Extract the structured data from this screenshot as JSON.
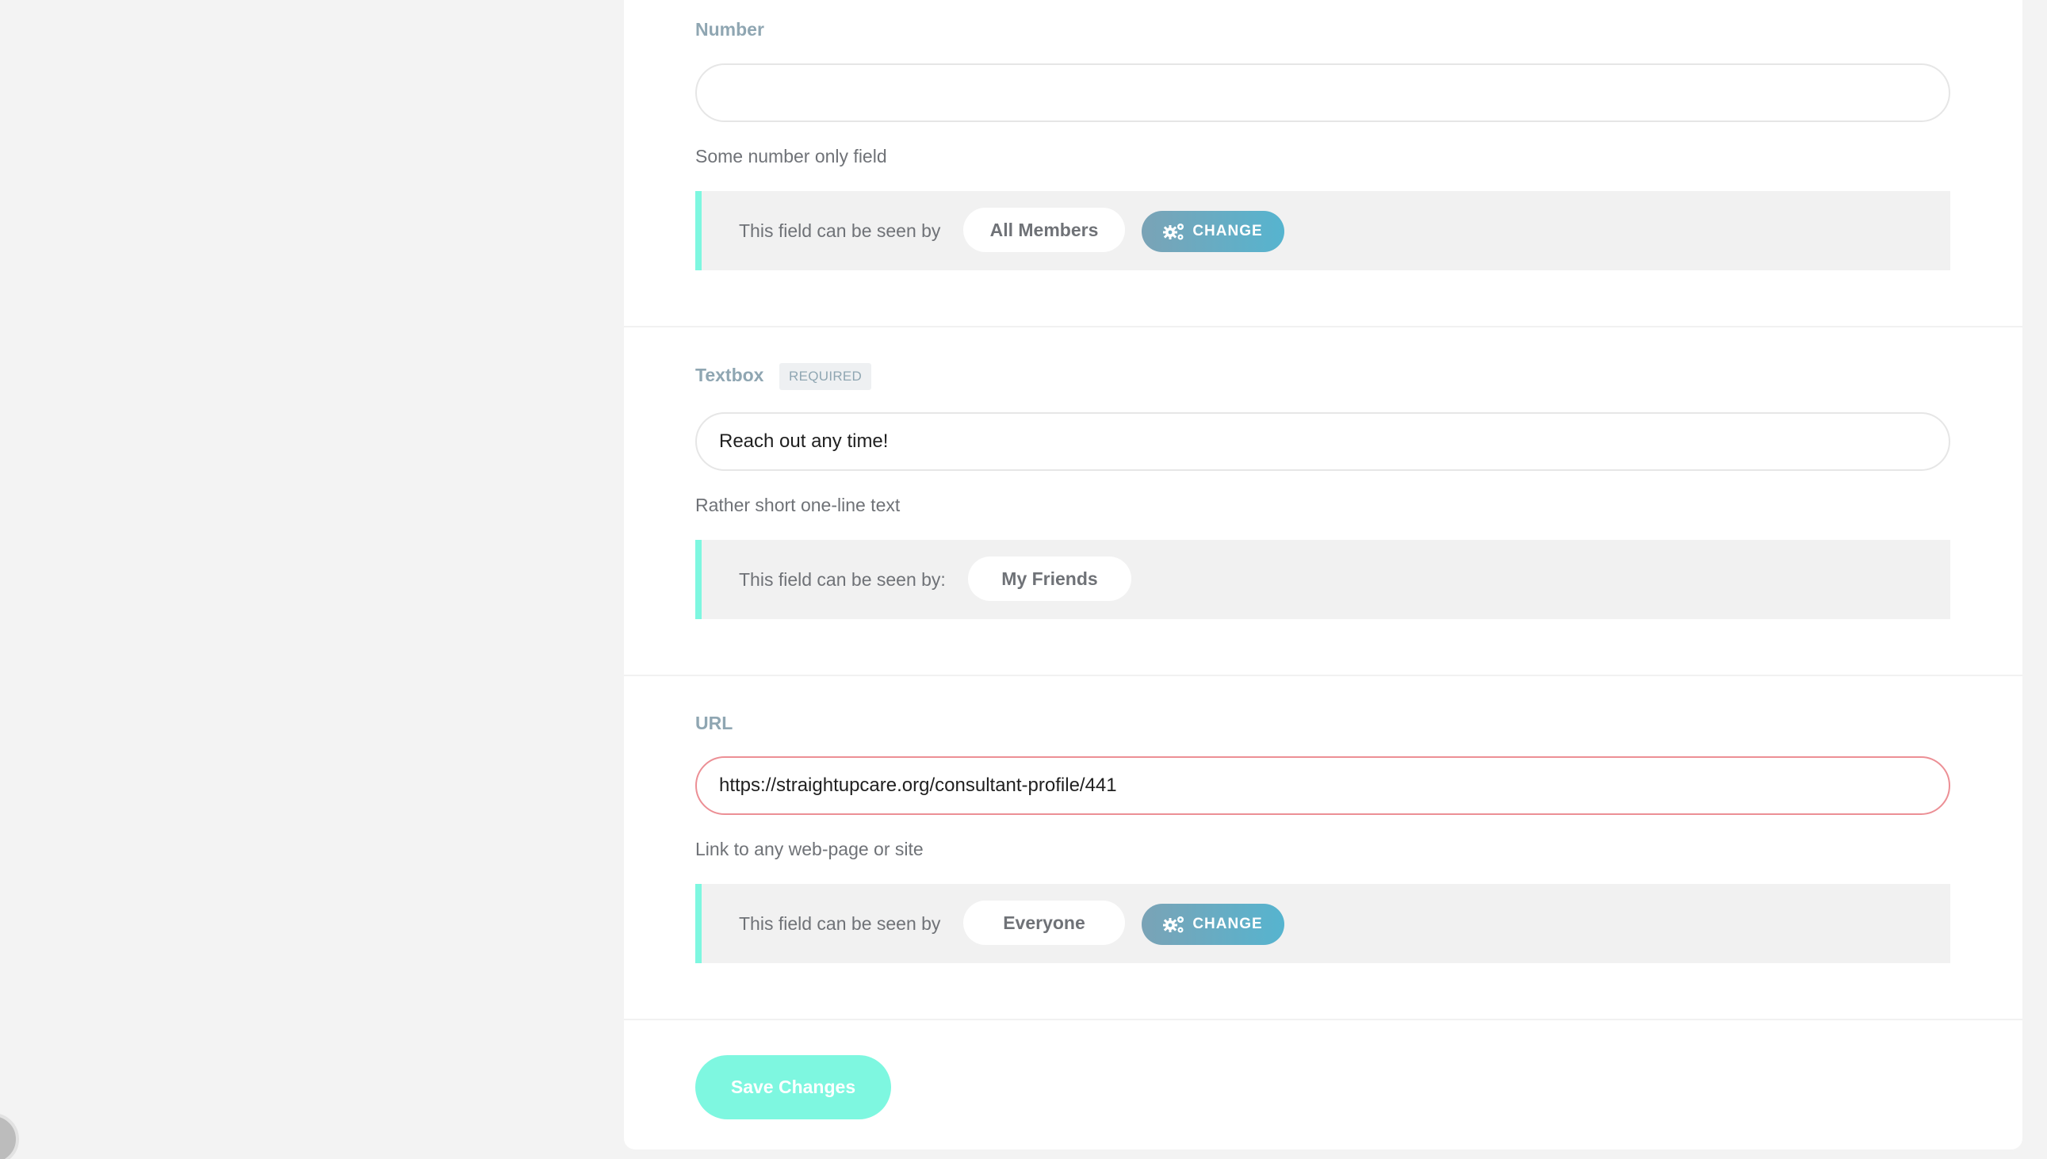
{
  "fields": [
    {
      "label": "Number",
      "required": false,
      "value": "",
      "help": "Some number only field",
      "visibility_text": "This field can be seen by",
      "visibility_level": "All Members",
      "change_label": "CHANGE"
    },
    {
      "label": "Textbox",
      "required": true,
      "required_label": "REQUIRED",
      "value": "Reach out any time!",
      "help": "Rather short one-line text",
      "visibility_text": "This field can be seen by:",
      "visibility_level": "My Friends"
    },
    {
      "label": "URL",
      "required": false,
      "value": "https://straightupcare.org/consultant-profile/441",
      "help": "Link to any web-page or site",
      "visibility_text": "This field can be seen by",
      "visibility_level": "Everyone",
      "change_label": "CHANGE"
    }
  ],
  "save_label": "Save Changes",
  "colors": {
    "accent": "#7ef7e0",
    "label": "#8fa6b2",
    "invalid_border": "#ec8f95",
    "change_start": "#7aa3b6",
    "change_end": "#56b4cf"
  },
  "icons": {
    "change": "gears-icon"
  }
}
